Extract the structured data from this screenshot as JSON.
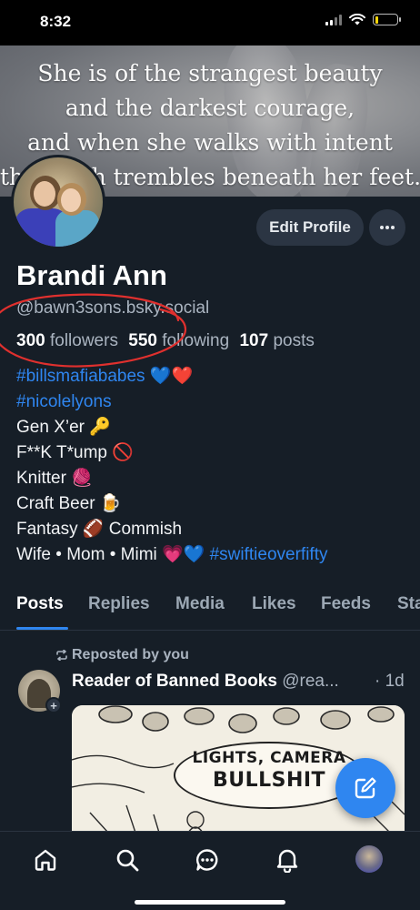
{
  "status_bar": {
    "time": "8:32"
  },
  "banner": {
    "lines": [
      "She is of the strangest beauty",
      "and the darkest courage,",
      "and when she walks with intent",
      "the earth trembles beneath her feet."
    ]
  },
  "profile": {
    "edit_label": "Edit Profile",
    "display_name": "Brandi Ann",
    "handle": "@bawn3sons.bsky.social",
    "followers_count": "300",
    "followers_label": "followers",
    "following_count": "550",
    "following_label": "following",
    "posts_count": "107",
    "posts_label": "posts",
    "bio": {
      "tag1": "#billsmafiababes",
      "tag1_emoji": "💙❤️",
      "tag2": "#nicolelyons",
      "line3": "Gen X’er 🔑",
      "line4": "F**K T*ump 🚫",
      "line5": "Knitter 🧶",
      "line6": "Craft Beer 🍺",
      "line7": "Fantasy 🏈 Commish",
      "line8_text": "Wife • Mom • Mimi 💗💙 ",
      "line8_tag": "#swiftieoverfifty"
    }
  },
  "tabs": [
    "Posts",
    "Replies",
    "Media",
    "Likes",
    "Feeds",
    "Starter Packs"
  ],
  "post": {
    "repost_label": "Reposted by you",
    "author": "Reader of Banned Books",
    "handle": " @rea...",
    "time": "· 1d",
    "image_text_1": "LIGHTS, CAMERA",
    "image_text_2": "BULLSHIT"
  },
  "icons": {
    "nav": [
      "home-icon",
      "search-icon",
      "chat-icon",
      "bell-icon",
      "profile-avatar"
    ],
    "fab": "compose-icon"
  },
  "colors": {
    "background": "#161e27",
    "accent": "#2f86f0",
    "annotation": "#e0302e"
  }
}
